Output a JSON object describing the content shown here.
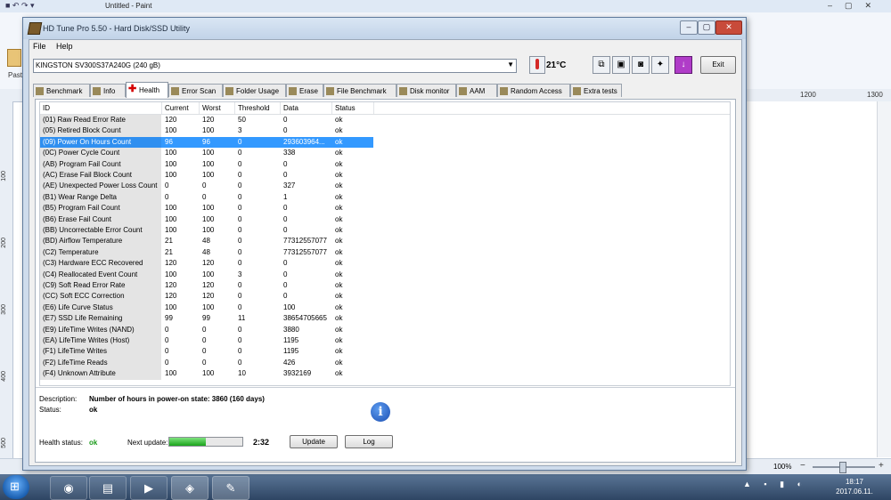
{
  "paint": {
    "title": "Untitled - Paint",
    "paste_label": "Past",
    "ruler_h": [
      "1200",
      "1300"
    ],
    "ruler_v": [
      "100",
      "200",
      "300",
      "400",
      "500"
    ],
    "zoom": "100%",
    "zoom_minus": "−",
    "zoom_plus": "+"
  },
  "window": {
    "title": "HD Tune Pro 5.50 - Hard Disk/SSD Utility",
    "buttons": [
      "–",
      "▢",
      "✕"
    ]
  },
  "menu": [
    "File",
    "Help"
  ],
  "drive": {
    "selected": "KINGSTON SV300S37A240G (240 gB)"
  },
  "temperature": "21°C",
  "exit_label": "Exit",
  "tabs": [
    "Benchmark",
    "Info",
    "Health",
    "Error Scan",
    "Folder Usage",
    "Erase",
    "File Benchmark",
    "Disk monitor",
    "AAM",
    "Random Access",
    "Extra tests"
  ],
  "active_tab": "Health",
  "columns": [
    "ID",
    "Current",
    "Worst",
    "Threshold",
    "Data",
    "Status"
  ],
  "rows": [
    [
      "(01) Raw Read Error Rate",
      "120",
      "120",
      "50",
      "0",
      "ok"
    ],
    [
      "(05) Retired Block Count",
      "100",
      "100",
      "3",
      "0",
      "ok"
    ],
    [
      "(09) Power On Hours Count",
      "96",
      "96",
      "0",
      "293603964...",
      "ok"
    ],
    [
      "(0C) Power Cycle Count",
      "100",
      "100",
      "0",
      "338",
      "ok"
    ],
    [
      "(AB) Program Fail Count",
      "100",
      "100",
      "0",
      "0",
      "ok"
    ],
    [
      "(AC) Erase Fail Block Count",
      "100",
      "100",
      "0",
      "0",
      "ok"
    ],
    [
      "(AE) Unexpected Power Loss Count",
      "0",
      "0",
      "0",
      "327",
      "ok"
    ],
    [
      "(B1) Wear Range Delta",
      "0",
      "0",
      "0",
      "1",
      "ok"
    ],
    [
      "(B5) Program Fail Count",
      "100",
      "100",
      "0",
      "0",
      "ok"
    ],
    [
      "(B6) Erase Fail Count",
      "100",
      "100",
      "0",
      "0",
      "ok"
    ],
    [
      "(BB) Uncorrectable Error Count",
      "100",
      "100",
      "0",
      "0",
      "ok"
    ],
    [
      "(BD) Airflow Temperature",
      "21",
      "48",
      "0",
      "77312557077",
      "ok"
    ],
    [
      "(C2) Temperature",
      "21",
      "48",
      "0",
      "77312557077",
      "ok"
    ],
    [
      "(C3) Hardware ECC Recovered",
      "120",
      "120",
      "0",
      "0",
      "ok"
    ],
    [
      "(C4) Reallocated Event Count",
      "100",
      "100",
      "3",
      "0",
      "ok"
    ],
    [
      "(C9) Soft Read Error Rate",
      "120",
      "120",
      "0",
      "0",
      "ok"
    ],
    [
      "(CC) Soft ECC Correction",
      "120",
      "120",
      "0",
      "0",
      "ok"
    ],
    [
      "(E6) Life Curve Status",
      "100",
      "100",
      "0",
      "100",
      "ok"
    ],
    [
      "(E7) SSD Life Remaining",
      "99",
      "99",
      "11",
      "38654705665",
      "ok"
    ],
    [
      "(E9) LifeTime Writes (NAND)",
      "0",
      "0",
      "0",
      "3880",
      "ok"
    ],
    [
      "(EA) LifeTime Writes (Host)",
      "0",
      "0",
      "0",
      "1195",
      "ok"
    ],
    [
      "(F1) LifeTime Writes",
      "0",
      "0",
      "0",
      "1195",
      "ok"
    ],
    [
      "(F2) LifeTime Reads",
      "0",
      "0",
      "0",
      "426",
      "ok"
    ],
    [
      "(F4) Unknown Attribute",
      "100",
      "100",
      "10",
      "3932169",
      "ok"
    ]
  ],
  "selected_row": 2,
  "description": {
    "label": "Description:",
    "value": "Number of hours in power-on state: 3860 (160 days)",
    "status_label": "Status:",
    "status_value": "ok"
  },
  "health": {
    "label": "Health status:",
    "value": "ok",
    "next_update_label": "Next update:",
    "progress": 0.5,
    "countdown": "2:32",
    "update_label": "Update",
    "log_label": "Log"
  },
  "taskbar": {
    "clock_time": "18:17",
    "clock_date": "2017.06.11."
  },
  "colors": {
    "selection": "#3399ff",
    "ok_green": "#1a9a1a",
    "progress": "#1aa31a"
  }
}
